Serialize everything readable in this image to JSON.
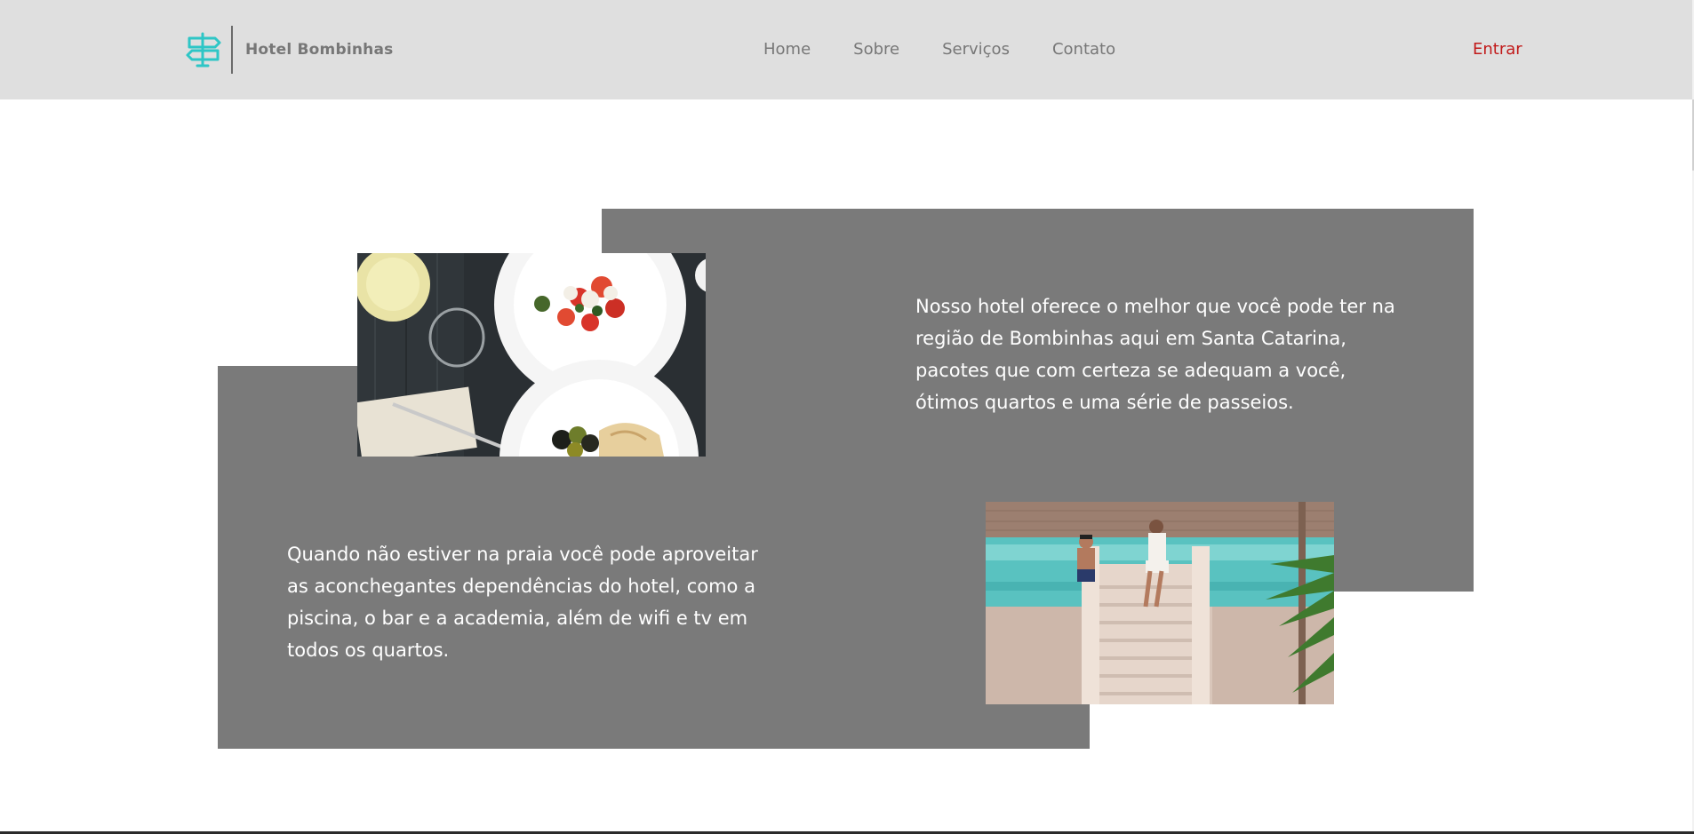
{
  "header": {
    "brand": "Hotel Bombinhas",
    "logo_icon": "signpost-icon",
    "nav": [
      {
        "label": "Home"
      },
      {
        "label": "Sobre"
      },
      {
        "label": "Serviços"
      },
      {
        "label": "Contato"
      }
    ],
    "login_label": "Entrar"
  },
  "content": {
    "feature_1": {
      "image": "restaurant-dishes-photo",
      "text": "Nosso hotel oferece o melhor que você pode ter na região de Bombinhas aqui em Santa Catarina, pacotes que com certeza se adequam a você, ótimos quartos e uma série de passeios."
    },
    "feature_2": {
      "image": "pool-couple-photo",
      "text": "Quando não estiver na praia você pode aproveitar as aconchegantes dependências do hotel, como a piscina, o bar e a academia, além de wifi e tv em todos os quartos."
    }
  },
  "colors": {
    "header_bg": "#dfdfdf",
    "block_bg": "#7a7a7a",
    "accent_logo": "#2ec6c6",
    "login": "#c11a1a",
    "nav_text": "#777777"
  }
}
